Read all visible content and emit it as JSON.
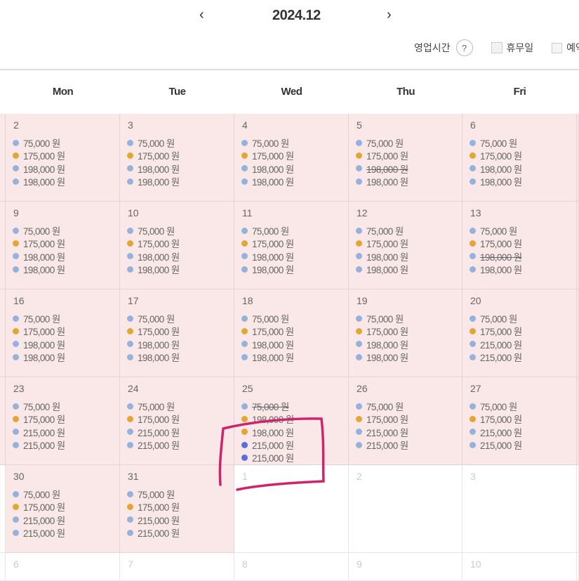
{
  "header": {
    "title": "2024.12",
    "prev_icon": "chevron-left-icon",
    "next_icon": "chevron-right-icon",
    "prev": "‹",
    "next": "›"
  },
  "legend": {
    "hours_label": "영업시간",
    "help": "?",
    "holiday_label": "휴무일",
    "reserve_label": "예약"
  },
  "weekdays": [
    "Mon",
    "Tue",
    "Wed",
    "Thu",
    "Fri"
  ],
  "colors": {
    "blue": "#94b2dc",
    "orange": "#e2a733",
    "indigo": "#5b6ed8",
    "annotation": "#d0246a"
  },
  "unit": "원",
  "weeks": [
    [
      {
        "day": "2",
        "items": [
          [
            "75,000",
            "blue"
          ],
          [
            "175,000",
            "orange"
          ],
          [
            "198,000",
            "blue"
          ],
          [
            "198,000",
            "blue"
          ]
        ]
      },
      {
        "day": "3",
        "items": [
          [
            "75,000",
            "blue"
          ],
          [
            "175,000",
            "orange"
          ],
          [
            "198,000",
            "blue"
          ],
          [
            "198,000",
            "blue"
          ]
        ]
      },
      {
        "day": "4",
        "items": [
          [
            "75,000",
            "blue"
          ],
          [
            "175,000",
            "orange"
          ],
          [
            "198,000",
            "blue"
          ],
          [
            "198,000",
            "blue"
          ]
        ]
      },
      {
        "day": "5",
        "items": [
          [
            "75,000",
            "blue"
          ],
          [
            "175,000",
            "orange"
          ],
          [
            "198,000",
            "blue",
            true
          ],
          [
            "198,000",
            "blue"
          ]
        ]
      },
      {
        "day": "6",
        "items": [
          [
            "75,000",
            "blue"
          ],
          [
            "175,000",
            "orange"
          ],
          [
            "198,000",
            "blue"
          ],
          [
            "198,000",
            "blue"
          ]
        ]
      }
    ],
    [
      {
        "day": "9",
        "items": [
          [
            "75,000",
            "blue"
          ],
          [
            "175,000",
            "orange"
          ],
          [
            "198,000",
            "blue"
          ],
          [
            "198,000",
            "blue"
          ]
        ]
      },
      {
        "day": "10",
        "items": [
          [
            "75,000",
            "blue"
          ],
          [
            "175,000",
            "orange"
          ],
          [
            "198,000",
            "blue"
          ],
          [
            "198,000",
            "blue"
          ]
        ]
      },
      {
        "day": "11",
        "items": [
          [
            "75,000",
            "blue"
          ],
          [
            "175,000",
            "orange"
          ],
          [
            "198,000",
            "blue"
          ],
          [
            "198,000",
            "blue"
          ]
        ]
      },
      {
        "day": "12",
        "items": [
          [
            "75,000",
            "blue"
          ],
          [
            "175,000",
            "orange"
          ],
          [
            "198,000",
            "blue"
          ],
          [
            "198,000",
            "blue"
          ]
        ]
      },
      {
        "day": "13",
        "items": [
          [
            "75,000",
            "blue"
          ],
          [
            "175,000",
            "orange"
          ],
          [
            "198,000",
            "blue",
            true
          ],
          [
            "198,000",
            "blue"
          ]
        ]
      }
    ],
    [
      {
        "day": "16",
        "items": [
          [
            "75,000",
            "blue"
          ],
          [
            "175,000",
            "orange"
          ],
          [
            "198,000",
            "blue"
          ],
          [
            "198,000",
            "blue"
          ]
        ]
      },
      {
        "day": "17",
        "items": [
          [
            "75,000",
            "blue"
          ],
          [
            "175,000",
            "orange"
          ],
          [
            "198,000",
            "blue"
          ],
          [
            "198,000",
            "blue"
          ]
        ]
      },
      {
        "day": "18",
        "items": [
          [
            "75,000",
            "blue"
          ],
          [
            "175,000",
            "orange"
          ],
          [
            "198,000",
            "blue"
          ],
          [
            "198,000",
            "blue"
          ]
        ]
      },
      {
        "day": "19",
        "items": [
          [
            "75,000",
            "blue"
          ],
          [
            "175,000",
            "orange"
          ],
          [
            "198,000",
            "blue"
          ],
          [
            "198,000",
            "blue"
          ]
        ]
      },
      {
        "day": "20",
        "items": [
          [
            "75,000",
            "blue"
          ],
          [
            "175,000",
            "orange"
          ],
          [
            "215,000",
            "blue"
          ],
          [
            "215,000",
            "blue"
          ]
        ]
      }
    ],
    [
      {
        "day": "23",
        "items": [
          [
            "75,000",
            "blue"
          ],
          [
            "175,000",
            "orange"
          ],
          [
            "215,000",
            "blue"
          ],
          [
            "215,000",
            "blue"
          ]
        ]
      },
      {
        "day": "24",
        "items": [
          [
            "75,000",
            "blue"
          ],
          [
            "175,000",
            "orange"
          ],
          [
            "215,000",
            "blue"
          ],
          [
            "215,000",
            "blue"
          ]
        ]
      },
      {
        "day": "25",
        "items": [
          [
            "75,000",
            "blue",
            true
          ],
          [
            "198,000",
            "orange"
          ],
          [
            "198,000",
            "orange"
          ],
          [
            "215,000",
            "indigo"
          ],
          [
            "215,000",
            "indigo"
          ]
        ]
      },
      {
        "day": "26",
        "items": [
          [
            "75,000",
            "blue"
          ],
          [
            "175,000",
            "orange"
          ],
          [
            "215,000",
            "blue"
          ],
          [
            "215,000",
            "blue"
          ]
        ]
      },
      {
        "day": "27",
        "items": [
          [
            "75,000",
            "blue"
          ],
          [
            "175,000",
            "orange"
          ],
          [
            "215,000",
            "blue"
          ],
          [
            "215,000",
            "blue"
          ]
        ]
      }
    ],
    [
      {
        "day": "30",
        "items": [
          [
            "75,000",
            "blue"
          ],
          [
            "175,000",
            "orange"
          ],
          [
            "215,000",
            "blue"
          ],
          [
            "215,000",
            "blue"
          ]
        ]
      },
      {
        "day": "31",
        "items": [
          [
            "75,000",
            "blue"
          ],
          [
            "175,000",
            "orange"
          ],
          [
            "215,000",
            "blue"
          ],
          [
            "215,000",
            "blue"
          ]
        ]
      },
      {
        "day": "1",
        "other": true,
        "items": []
      },
      {
        "day": "2",
        "other": true,
        "items": []
      },
      {
        "day": "3",
        "other": true,
        "items": []
      }
    ],
    [
      {
        "day": "6",
        "other": true,
        "items": []
      },
      {
        "day": "7",
        "other": true,
        "items": []
      },
      {
        "day": "8",
        "other": true,
        "items": []
      },
      {
        "day": "9",
        "other": true,
        "items": []
      },
      {
        "day": "10",
        "other": true,
        "items": []
      }
    ]
  ]
}
